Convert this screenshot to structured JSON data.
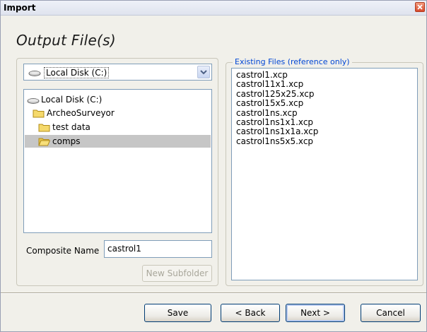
{
  "window": {
    "title": "Import"
  },
  "heading": "Output File(s)",
  "drive_selector": {
    "value": "Local Disk (C:)"
  },
  "tree": [
    {
      "label": "Local Disk (C:)",
      "icon": "drive-icon"
    },
    {
      "label": "ArcheoSurveyor",
      "icon": "folder-icon"
    },
    {
      "label": "test data",
      "icon": "folder-icon"
    },
    {
      "label": "comps",
      "icon": "folder-open-icon",
      "selected": true
    }
  ],
  "composite": {
    "label": "Composite Name",
    "value": "castrol1"
  },
  "new_subfolder_label": "New Subfolder",
  "existing_files": {
    "legend": "Existing Files (reference only)",
    "items": [
      "castrol1.xcp",
      "castrol11x1.xcp",
      "castrol125x25.xcp",
      "castrol15x5.xcp",
      "castrol1ns.xcp",
      "castrol1ns1x1.xcp",
      "castrol1ns1x1a.xcp",
      "castrol1ns5x5.xcp"
    ]
  },
  "buttons": {
    "save": "Save",
    "back": "< Back",
    "next": "Next >",
    "cancel": "Cancel"
  },
  "colors": {
    "accent": "#0046d5",
    "selection": "#c6c6c6",
    "close": "#d6492a"
  }
}
